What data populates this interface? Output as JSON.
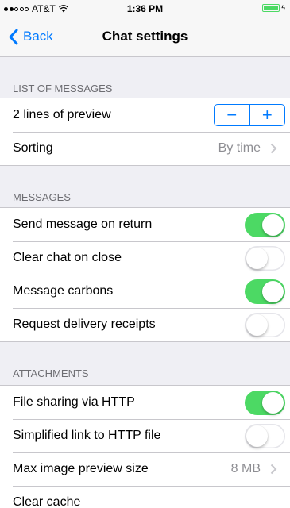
{
  "status_bar": {
    "signal_filled": 2,
    "signal_empty": 3,
    "carrier": "AT&T",
    "time": "1:36 PM",
    "battery_level": 1.0
  },
  "nav": {
    "back_label": "Back",
    "title": "Chat settings"
  },
  "sections": {
    "list_of_messages": {
      "header": "LIST OF MESSAGES",
      "preview_label": "2 lines of preview",
      "stepper_minus": "−",
      "stepper_plus": "+",
      "sorting_label": "Sorting",
      "sorting_value": "By time"
    },
    "messages": {
      "header": "MESSAGES",
      "items": [
        {
          "label": "Send message on return",
          "on": true
        },
        {
          "label": "Clear chat on close",
          "on": false
        },
        {
          "label": "Message carbons",
          "on": true
        },
        {
          "label": "Request delivery receipts",
          "on": false
        }
      ]
    },
    "attachments": {
      "header": "ATTACHMENTS",
      "file_sharing_label": "File sharing via HTTP",
      "file_sharing_on": true,
      "simplified_link_label": "Simplified link to HTTP file",
      "simplified_link_on": false,
      "max_preview_label": "Max image preview size",
      "max_preview_value": "8 MB",
      "clear_cache_label": "Clear cache"
    }
  },
  "colors": {
    "accent": "#007aff",
    "toggle_on": "#4cd964",
    "background": "#efeff4"
  }
}
